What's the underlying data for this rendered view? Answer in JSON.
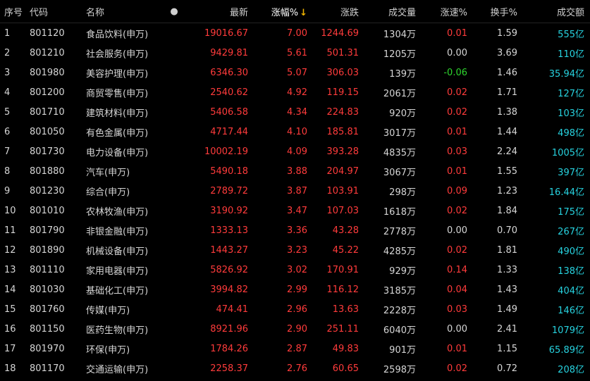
{
  "header": {
    "idx": "序号",
    "code": "代码",
    "name": "名称",
    "dot": "●",
    "last": "最新",
    "pct": "涨幅%",
    "sort_arrow": "↓",
    "chg": "涨跌",
    "vol": "成交量",
    "speed": "涨速%",
    "turn": "换手%",
    "amt": "成交额"
  },
  "rows": [
    {
      "idx": "1",
      "code": "801120",
      "name": "食品饮料(申万)",
      "last": "19016.67",
      "pct": "7.00",
      "chg": "1244.69",
      "vol": "1304万",
      "speed": "0.01",
      "turn": "1.59",
      "amt": "555亿"
    },
    {
      "idx": "2",
      "code": "801210",
      "name": "社会服务(申万)",
      "last": "9429.81",
      "pct": "5.61",
      "chg": "501.31",
      "vol": "1205万",
      "speed": "0.00",
      "turn": "3.69",
      "amt": "110亿"
    },
    {
      "idx": "3",
      "code": "801980",
      "name": "美容护理(申万)",
      "last": "6346.30",
      "pct": "5.07",
      "chg": "306.03",
      "vol": "139万",
      "speed": "-0.06",
      "turn": "1.46",
      "amt": "35.94亿"
    },
    {
      "idx": "4",
      "code": "801200",
      "name": "商贸零售(申万)",
      "last": "2540.62",
      "pct": "4.92",
      "chg": "119.15",
      "vol": "2061万",
      "speed": "0.02",
      "turn": "1.71",
      "amt": "127亿"
    },
    {
      "idx": "5",
      "code": "801710",
      "name": "建筑材料(申万)",
      "last": "5406.58",
      "pct": "4.34",
      "chg": "224.83",
      "vol": "920万",
      "speed": "0.02",
      "turn": "1.38",
      "amt": "103亿"
    },
    {
      "idx": "6",
      "code": "801050",
      "name": "有色金属(申万)",
      "last": "4717.44",
      "pct": "4.10",
      "chg": "185.81",
      "vol": "3017万",
      "speed": "0.01",
      "turn": "1.44",
      "amt": "498亿"
    },
    {
      "idx": "7",
      "code": "801730",
      "name": "电力设备(申万)",
      "last": "10002.19",
      "pct": "4.09",
      "chg": "393.28",
      "vol": "4835万",
      "speed": "0.03",
      "turn": "2.24",
      "amt": "1005亿"
    },
    {
      "idx": "8",
      "code": "801880",
      "name": "汽车(申万)",
      "last": "5490.18",
      "pct": "3.88",
      "chg": "204.97",
      "vol": "3067万",
      "speed": "0.01",
      "turn": "1.55",
      "amt": "397亿"
    },
    {
      "idx": "9",
      "code": "801230",
      "name": "综合(申万)",
      "last": "2789.72",
      "pct": "3.87",
      "chg": "103.91",
      "vol": "298万",
      "speed": "0.09",
      "turn": "1.23",
      "amt": "16.44亿"
    },
    {
      "idx": "10",
      "code": "801010",
      "name": "农林牧渔(申万)",
      "last": "3190.92",
      "pct": "3.47",
      "chg": "107.03",
      "vol": "1618万",
      "speed": "0.02",
      "turn": "1.84",
      "amt": "175亿"
    },
    {
      "idx": "11",
      "code": "801790",
      "name": "非银金融(申万)",
      "last": "1333.13",
      "pct": "3.36",
      "chg": "43.28",
      "vol": "2778万",
      "speed": "0.00",
      "turn": "0.70",
      "amt": "267亿"
    },
    {
      "idx": "12",
      "code": "801890",
      "name": "机械设备(申万)",
      "last": "1443.27",
      "pct": "3.23",
      "chg": "45.22",
      "vol": "4285万",
      "speed": "0.02",
      "turn": "1.81",
      "amt": "490亿"
    },
    {
      "idx": "13",
      "code": "801110",
      "name": "家用电器(申万)",
      "last": "5826.92",
      "pct": "3.02",
      "chg": "170.91",
      "vol": "929万",
      "speed": "0.14",
      "turn": "1.33",
      "amt": "138亿"
    },
    {
      "idx": "14",
      "code": "801030",
      "name": "基础化工(申万)",
      "last": "3994.82",
      "pct": "2.99",
      "chg": "116.12",
      "vol": "3185万",
      "speed": "0.04",
      "turn": "1.43",
      "amt": "404亿"
    },
    {
      "idx": "15",
      "code": "801760",
      "name": "传媒(申万)",
      "last": "474.41",
      "pct": "2.96",
      "chg": "13.63",
      "vol": "2228万",
      "speed": "0.03",
      "turn": "1.49",
      "amt": "146亿"
    },
    {
      "idx": "16",
      "code": "801150",
      "name": "医药生物(申万)",
      "last": "8921.96",
      "pct": "2.90",
      "chg": "251.11",
      "vol": "6040万",
      "speed": "0.00",
      "turn": "2.41",
      "amt": "1079亿"
    },
    {
      "idx": "17",
      "code": "801970",
      "name": "环保(申万)",
      "last": "1784.26",
      "pct": "2.87",
      "chg": "49.83",
      "vol": "901万",
      "speed": "0.01",
      "turn": "1.15",
      "amt": "65.89亿"
    },
    {
      "idx": "18",
      "code": "801170",
      "name": "交通运输(申万)",
      "last": "2258.37",
      "pct": "2.76",
      "chg": "60.65",
      "vol": "2598万",
      "speed": "0.02",
      "turn": "0.72",
      "amt": "208亿"
    }
  ],
  "colors": {
    "up": "#ff3b3b",
    "down": "#2ed62e",
    "amount": "#27d3e0",
    "sort_arrow": "#f0b400",
    "background": "#000000"
  }
}
